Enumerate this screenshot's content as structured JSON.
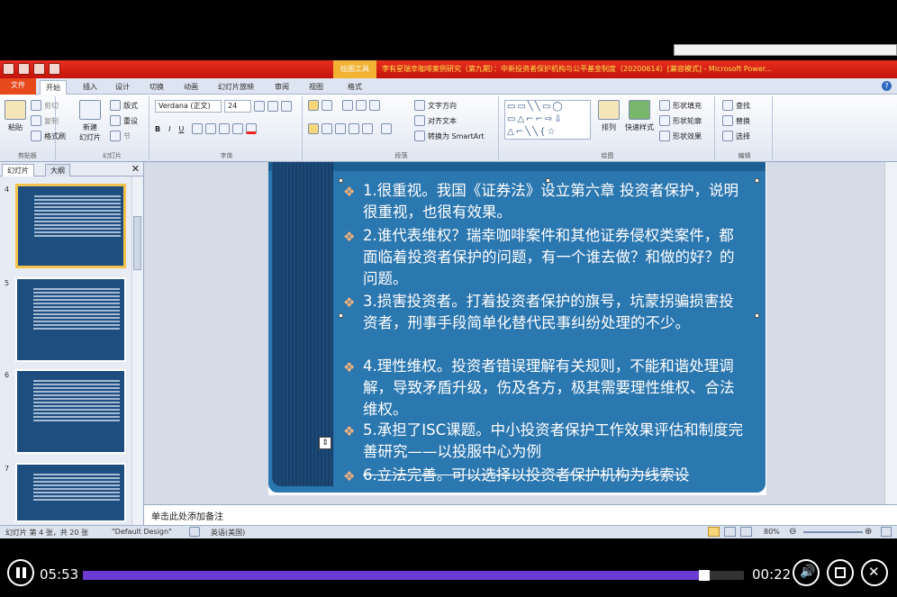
{
  "window": {
    "tool_tab": "绘图工具",
    "title": "李有星瑞幸咖啡案例研究（第九期）：中新投资者保护机构与公平基金制度（20200614）[兼容模式] - Microsoft Power..."
  },
  "tabs": {
    "file": "文件",
    "home": "开始",
    "insert": "插入",
    "design": "设计",
    "transitions": "切换",
    "animations": "动画",
    "slideshow": "幻灯片放映",
    "review": "审阅",
    "view": "视图",
    "format": "格式"
  },
  "ribbon": {
    "clipboard": {
      "paste": "粘贴",
      "cut": "剪切",
      "copy": "复制",
      "painter": "格式刷",
      "label": "剪贴板"
    },
    "slides": {
      "new_slide": "新建",
      "new_slide2": "幻灯片",
      "layout": "版式",
      "reset": "重设",
      "section": "节",
      "label": "幻灯片"
    },
    "font": {
      "name": "Verdana (正文)",
      "size": "24",
      "label": "字体"
    },
    "paragraph": {
      "text_direction": "文字方向",
      "align_text": "对齐文本",
      "smartart": "转换为 SmartArt",
      "label": "段落"
    },
    "drawing": {
      "arrange": "排列",
      "quick_styles": "快速样式",
      "fill": "形状填充",
      "outline": "形状轮廓",
      "effects": "形状效果",
      "label": "绘图"
    },
    "editing": {
      "find": "查找",
      "replace": "替换",
      "select": "选择",
      "label": "编辑"
    }
  },
  "leftpane": {
    "tab_slides": "幻灯片",
    "tab_outline": "大纲",
    "thumbs": [
      {
        "num": "4",
        "selected": true
      },
      {
        "num": "5",
        "selected": false
      },
      {
        "num": "6",
        "selected": false
      },
      {
        "num": "7",
        "selected": false
      }
    ]
  },
  "slide": {
    "bullets": [
      "1.很重视。我国《证券法》设立第六章 投资者保护，说明很重视，也很有效果。",
      "2.谁代表维权？瑞幸咖啡案件和其他证券侵权类案件，都面临着投资者保护的问题，有一个谁去做？和做的好？的问题。",
      "3.损害投资者。打着投资者保护的旗号，坑蒙拐骗损害投资者，刑事手段简单化替代民事纠纷处理的不少。",
      "4.理性维权。投资者错误理解有关规则，不能和谐处理调解，导致矛盾升级，伤及各方，极其需要理性维权、合法维权。",
      "5.承担了ISC课题。中小投资者保护工作效果评估和制度完善研究——以投服中心为例",
      "6.立法完善。可以选择以投资者保护机构为线索设"
    ],
    "bullet_mark": "❖"
  },
  "notes": {
    "placeholder": "单击此处添加备注"
  },
  "status": {
    "slide_info": "幻灯片 第 4 张，共 20 张",
    "theme": "\"Default Design\"",
    "language": "英语(美国)",
    "zoom": "80%"
  },
  "player": {
    "elapsed": "05:53",
    "remaining": "00:22",
    "progress": 0.94
  }
}
